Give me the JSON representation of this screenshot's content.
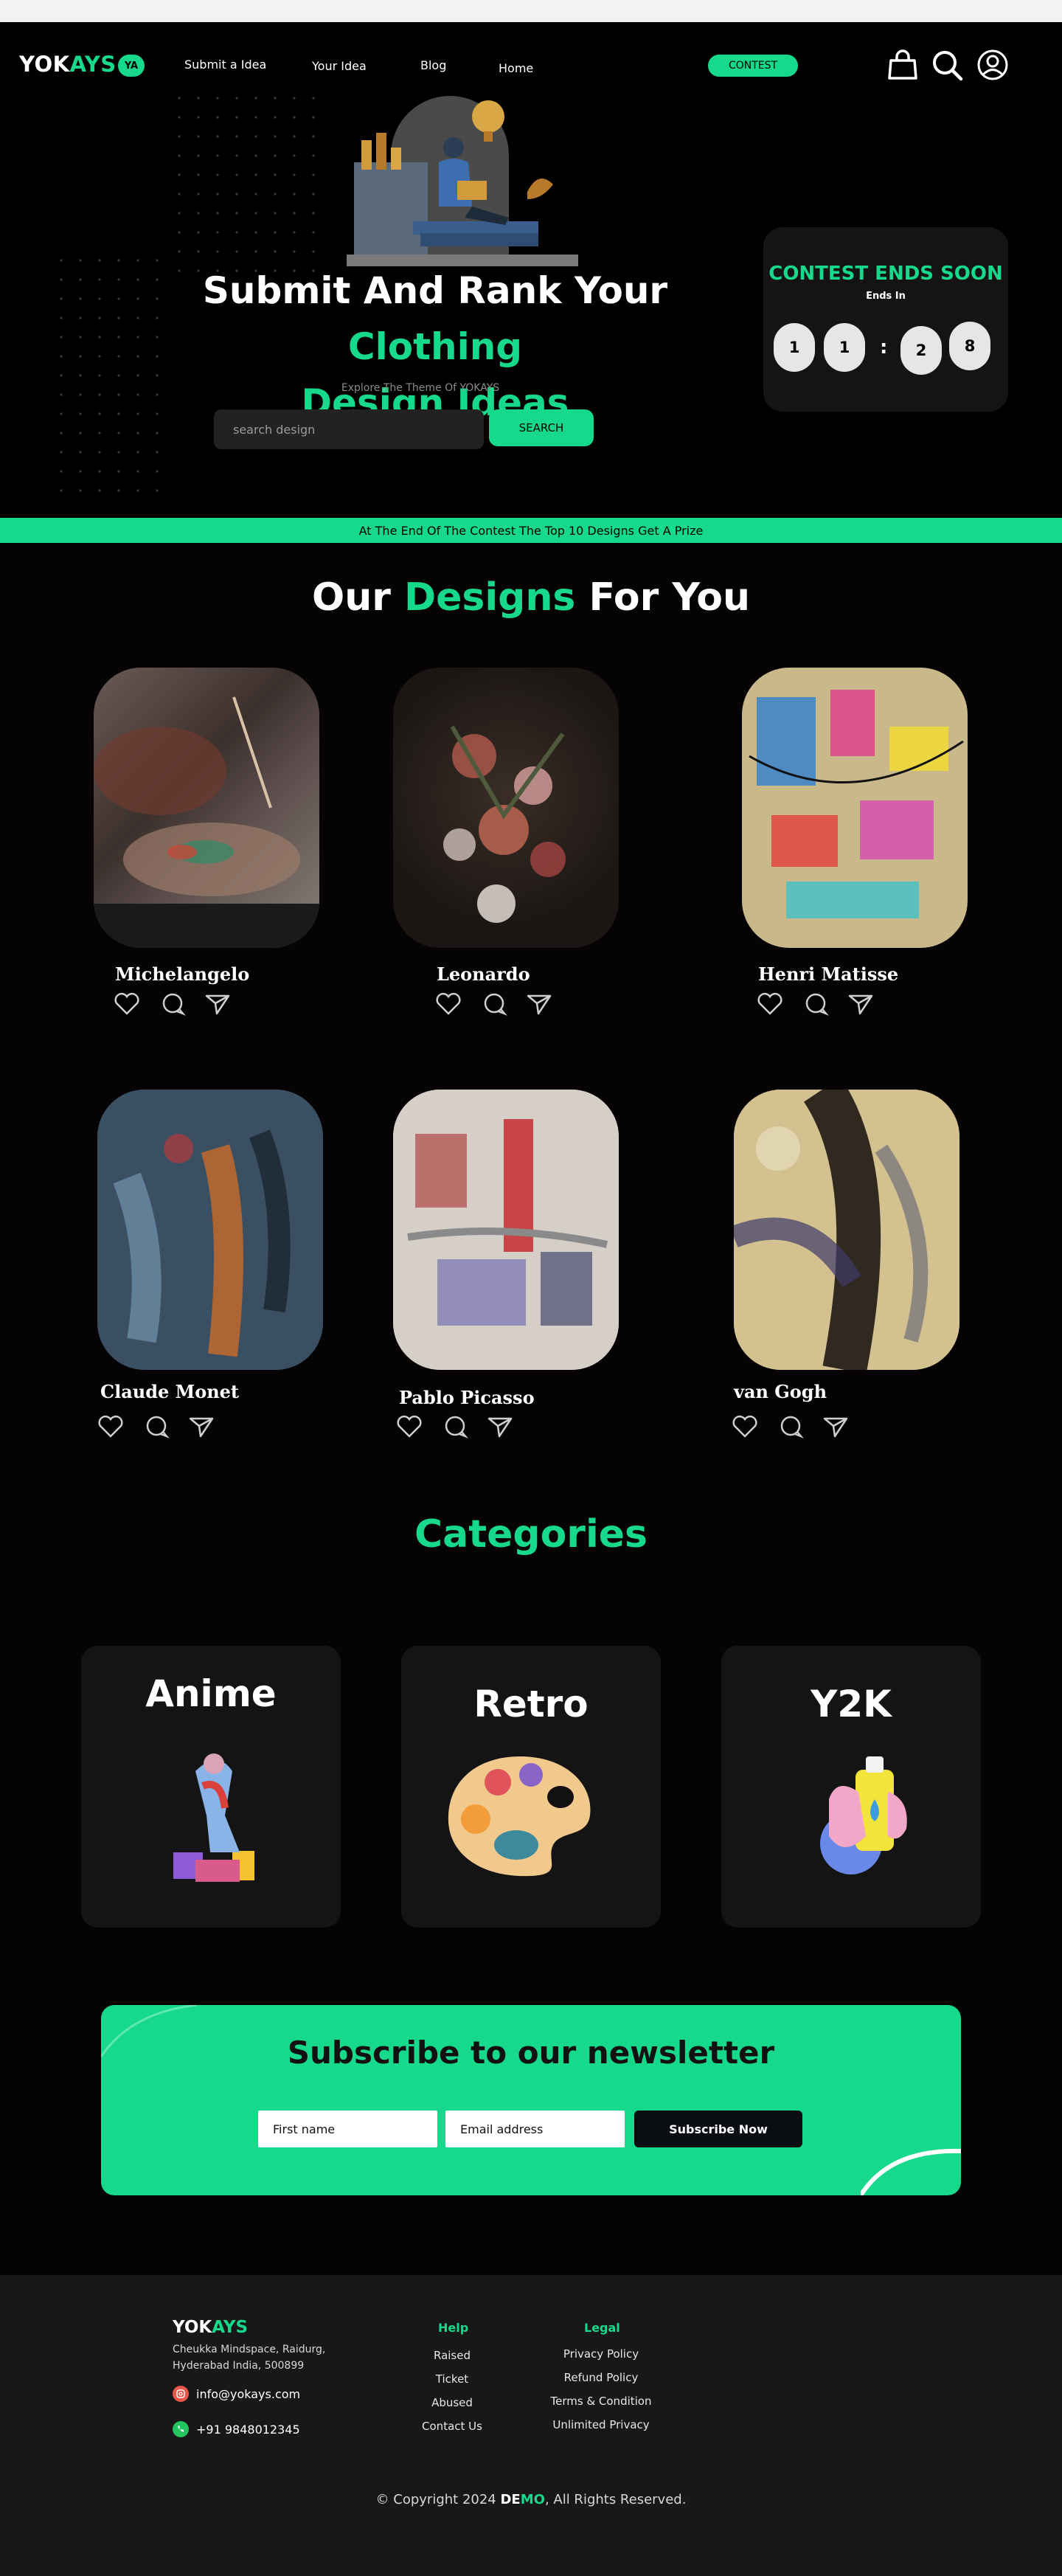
{
  "header": {
    "logo_white": "YOK",
    "logo_green": "AYS",
    "logo_badge": "YA",
    "nav": [
      "Submit a Idea",
      "Your Idea",
      "Blog",
      "Home"
    ],
    "contest_label": "CONTEST",
    "icons": [
      "shopping-bag-icon",
      "search-icon",
      "user-profile-icon"
    ]
  },
  "hero": {
    "title_white": "Submit And Rank Your ",
    "title_green_1": "Clothing",
    "title_green_2": "Design Ideas",
    "subtitle": "Explore The Theme Of YOKAYS",
    "search_placeholder": "search design",
    "search_button": "SEARCH"
  },
  "countdown": {
    "title": "CONTEST ENDS SOON",
    "subtitle": "Ends In",
    "digits": [
      "1",
      "1",
      "2",
      "8"
    ],
    "separator": ":"
  },
  "banner": "At The End Of The Contest The Top 10 Designs Get A Prize",
  "designs": {
    "title_1": "Our ",
    "title_green": "Designs",
    "title_2": " For You",
    "items": [
      {
        "artist": "Michelangelo"
      },
      {
        "artist": "Leonardo"
      },
      {
        "artist": "Henri Matisse"
      },
      {
        "artist": "Claude Monet"
      },
      {
        "artist": "Pablo Picasso"
      },
      {
        "artist": "van Gogh"
      }
    ]
  },
  "categories": {
    "title": "Categories",
    "items": [
      {
        "name": "Anime",
        "icon": "statue-figure-icon"
      },
      {
        "name": "Retro",
        "icon": "paint-palette-icon"
      },
      {
        "name": "Y2K",
        "icon": "spray-can-hand-icon"
      }
    ]
  },
  "newsletter": {
    "title": "Subscribe to our newsletter",
    "first_name_placeholder": "First name",
    "email_placeholder": "Email address",
    "button": "Subscribe Now"
  },
  "footer": {
    "logo_white": "YOK",
    "logo_green": "AYS",
    "address_1": "Cheukka Mindspace, Raidurg,",
    "address_2": "Hyderabad India, 500899",
    "email": "info@yokays.com",
    "phone": "+91 9848012345",
    "help_title": "Help",
    "help_links": [
      "Raised",
      "Ticket",
      "Abused",
      "Contact Us"
    ],
    "legal_title": "Legal",
    "legal_links": [
      "Privacy Policy",
      "Refund Policy",
      "Terms & Condition",
      "Unlimited Privacy"
    ],
    "copyright_prefix": "© Copyright 2024 ",
    "copyright_de": "DE",
    "copyright_mo": "MO",
    "copyright_suffix": ", All Rights Reserved."
  },
  "colors": {
    "accent": "#16d98b",
    "background": "#050304",
    "card": "#141414",
    "footer": "#181818"
  }
}
